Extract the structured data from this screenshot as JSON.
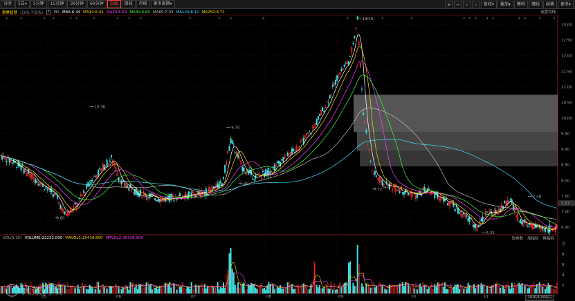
{
  "toolbar": {
    "tabs": [
      {
        "label": "分时",
        "active": false
      },
      {
        "label": "5日▾",
        "active": false
      },
      {
        "label": "5分钟",
        "active": false
      },
      {
        "label": "15分钟",
        "active": false
      },
      {
        "label": "30分钟",
        "active": false
      },
      {
        "label": "60分钟",
        "active": false
      },
      {
        "label": "日线",
        "active": true
      },
      {
        "label": "周线",
        "active": false
      },
      {
        "label": "月线",
        "active": false
      },
      {
        "label": "更多周期▾",
        "active": false
      }
    ],
    "right_buttons": [
      "复权▾",
      "叠加▾",
      "筹码",
      "缠线",
      "经典",
      "更多▾"
    ],
    "right_icons": [
      "plus-icon",
      "minus-icon",
      "chevron-left-icon",
      "chevron-right-icon"
    ]
  },
  "stock": {
    "name": "惠美智慧",
    "sub": "(日线,不复权)",
    "help": "?",
    "ma_label": "MA",
    "ma": [
      {
        "text": "MA5:6.44",
        "color": "#ffffff"
      },
      {
        "text": "MA10:6.44",
        "color": "#ffd700"
      },
      {
        "text": "MA20:6.62",
        "color": "#ff40ff"
      },
      {
        "text": "MA30:6.60",
        "color": "#40ff40"
      },
      {
        "text": "MA60:7.03",
        "color": "#c0c0c0"
      },
      {
        "text": "MA120:8.10",
        "color": "#40e0ff"
      },
      {
        "text": "MA250:8.72",
        "color": "#ffd700"
      }
    ],
    "settings_label": "设置均线"
  },
  "volume": {
    "label": "VOL(5,10)",
    "values": [
      {
        "text": "VOLUME:22222.000",
        "color": "#ffffff"
      },
      {
        "text": "MAVOL1:25416.600",
        "color": "#ffd700"
      },
      {
        "text": "MAVOL2:30336.900",
        "color": "#ff40ff"
      }
    ],
    "tools": [
      "改参数",
      "加指标",
      "换指标"
    ]
  },
  "annotations": {
    "high_label": "13.19",
    "low_label": "6.32",
    "peaks": [
      {
        "label": "10.36"
      },
      {
        "label": "9.70"
      },
      {
        "label": "7.48"
      }
    ],
    "troughs": [
      {
        "label": "6.80"
      },
      {
        "label": "7.36"
      },
      {
        "label": "7.91"
      },
      {
        "label": "7.72"
      }
    ]
  },
  "price_axis": [
    "13.00",
    "12.50",
    "12.00",
    "11.50",
    "11.00",
    "10.50",
    "10.00",
    "9.50",
    "9.00",
    "8.50",
    "8.00",
    "7.50",
    "7.00",
    "6.50"
  ],
  "current_price": "7.27",
  "vol_axis": [
    "万",
    "8",
    "6",
    "4",
    "2"
  ],
  "month_labels": [
    "05",
    "06",
    "07",
    "08",
    "09",
    "10",
    "11"
  ],
  "date_label": "2020/12/09/三",
  "watermark": "大数跨境",
  "colors": {
    "up": "#ff3232",
    "down": "#40e0e0",
    "ma5": "#ffffff",
    "ma10": "#ffd700",
    "ma20": "#ff40ff",
    "ma30": "#40ff40",
    "ma60": "#c0c0c0",
    "ma120": "#40e0ff"
  }
}
